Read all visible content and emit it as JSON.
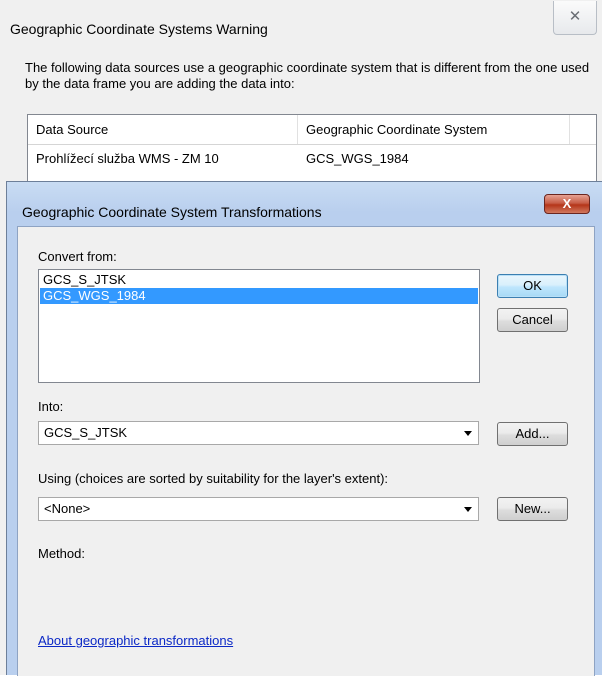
{
  "warning": {
    "title": "Geographic Coordinate Systems Warning",
    "close_glyph": "✕",
    "message": "The following data sources use a geographic coordinate system that is different from the one used by the data frame you are adding the data into:",
    "columns": [
      "Data Source",
      "Geographic Coordinate System"
    ],
    "rows": [
      {
        "source": "Prohlížecí služba WMS - ZM 10",
        "gcs": "GCS_WGS_1984"
      }
    ]
  },
  "dialog": {
    "title": "Geographic Coordinate System Transformations",
    "close_glyph": "X",
    "convert_from_label": "Convert from:",
    "convert_from_items": [
      "GCS_S_JTSK",
      "GCS_WGS_1984"
    ],
    "selected_index": 1,
    "into_label": "Into:",
    "into_value": "GCS_S_JTSK",
    "using_label": "Using (choices are sorted by suitability for the layer's extent):",
    "using_value": "<None>",
    "method_label": "Method:",
    "about_link": "About geographic transformations",
    "buttons": {
      "ok": "OK",
      "cancel": "Cancel",
      "add": "Add...",
      "new": "New..."
    }
  }
}
